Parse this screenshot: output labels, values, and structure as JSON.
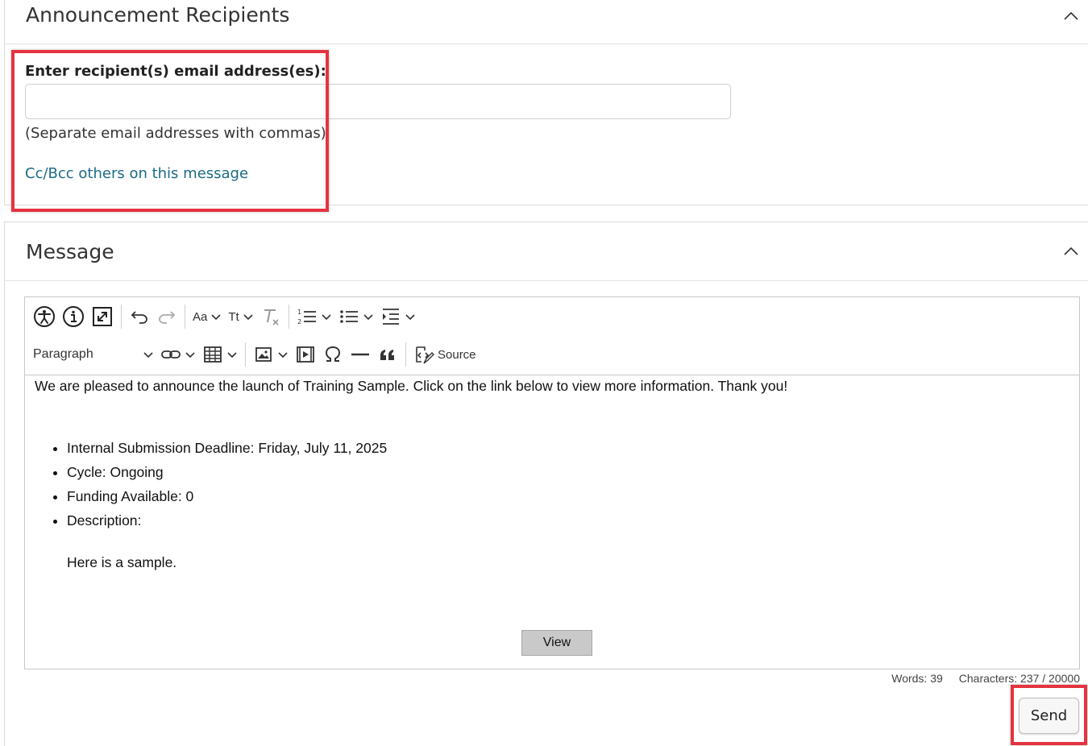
{
  "recipients_panel": {
    "title": "Announcement Recipients",
    "field_label": "Enter recipient(s) email address(es):",
    "email_value": "",
    "email_placeholder": "",
    "hint": "(Separate email addresses with commas)",
    "cc_bcc_link": "Cc/Bcc others on this message"
  },
  "message_panel": {
    "title": "Message",
    "toolbar": {
      "row1_icons": [
        "accessibility-icon",
        "info-icon",
        "maximize-icon",
        "undo-icon",
        "redo-icon",
        "font-family-icon",
        "font-size-icon",
        "remove-format-icon",
        "numbered-list-icon",
        "bulleted-list-icon",
        "indent-icon"
      ],
      "font_family_label": "Aa",
      "font_size_label": "Tt",
      "paragraph_label": "Paragraph",
      "source_label": "Source"
    },
    "content": {
      "intro": "We are pleased to announce the launch of Training Sample. Click on the link below to view more information. Thank you!",
      "bullets": [
        "Internal Submission Deadline: Friday, July 11, 2025",
        "Cycle: Ongoing",
        "Funding Available: 0",
        "Description:"
      ],
      "description_body": "Here is a sample.",
      "view_button": "View"
    },
    "counts": {
      "words": "Words: 39",
      "characters": "Characters: 237 / 20000"
    }
  },
  "send_button": "Send",
  "colors": {
    "highlight": "#e53340",
    "link": "#1b6b84"
  }
}
